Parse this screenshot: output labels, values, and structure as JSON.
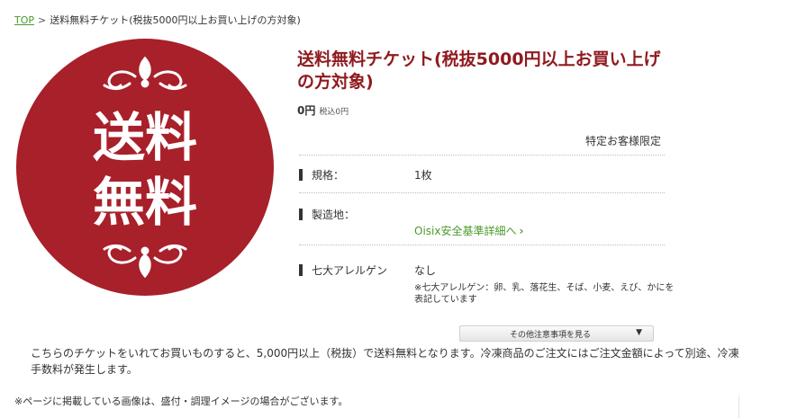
{
  "breadcrumb": {
    "home": "TOP",
    "separator": ">",
    "current": "送料無料チケット(税抜5000円以上お買い上げの方対象)"
  },
  "image": {
    "line1": "送料",
    "line2": "無料",
    "colors": {
      "badge": "#a8202a",
      "text": "#ffffff"
    }
  },
  "product": {
    "title": "送料無料チケット(税抜5000円以上お買い上げの方対象)",
    "price": "0円",
    "price_tax": "税込0円",
    "limited": "特定お客様限定"
  },
  "specs": {
    "standard_label": "規格：",
    "standard_value": "1枚",
    "origin_label": "製造地：",
    "origin_link": "Oisix安全基準詳細へ",
    "allergen_label": "七大アレルゲン",
    "allergen_value": "なし",
    "allergen_note": "※七大アレルゲン：卵、乳、落花生、そば、小麦、えび、かにを表記しています"
  },
  "more_button": {
    "label": "その他注意事項を見る",
    "icon": "triangle-down-icon"
  },
  "description": "こちらのチケットをいれてお買いものすると、5,000円以上（税抜）で送料無料となります。冷凍商品のご注文にはご注文金額によって別途、冷凍手数料が発生します。",
  "footnote": "※ページに掲載している画像は、盛付・調理イメージの場合がございます。",
  "colors": {
    "accent": "#8f1a1f",
    "link": "#4b9a2b"
  }
}
